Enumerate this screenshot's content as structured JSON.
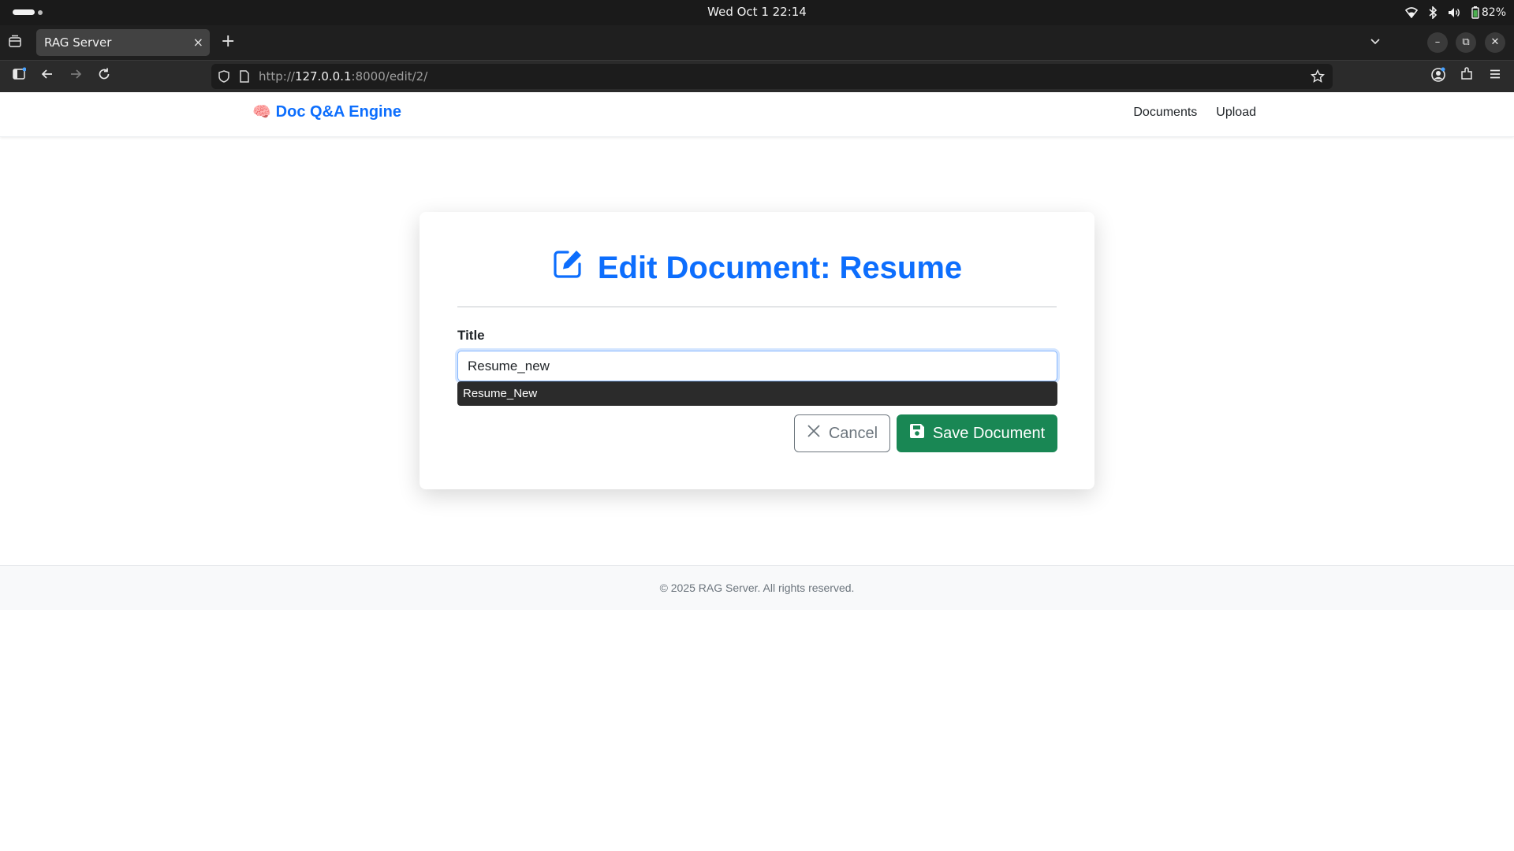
{
  "os": {
    "clock": "Wed Oct 1  22:14",
    "battery": "82%",
    "tray_icons": [
      "wifi-icon",
      "bluetooth-icon",
      "volume-icon",
      "battery-icon"
    ]
  },
  "browser": {
    "tab_title": "RAG Server",
    "tab_close": "×",
    "new_tab": "+",
    "url_prefix": "http://",
    "url_host": "127.0.0.1",
    "url_rest": ":8000/edit/2/",
    "window_minimize": "–",
    "window_restore": "⧉",
    "window_close": "✕"
  },
  "navbar": {
    "brand_icon": "🧠",
    "brand": "Doc Q&A Engine",
    "links": [
      "Documents",
      "Upload"
    ]
  },
  "form": {
    "heading": "Edit Document: Resume",
    "title_label": "Title",
    "title_value": "Resume_new",
    "autocomplete_suggestion": "Resume_New",
    "cancel_label": "Cancel",
    "save_label": "Save Document"
  },
  "footer": {
    "text": "© 2025 RAG Server. All rights reserved."
  },
  "colors": {
    "primary": "#0d6efd",
    "success": "#198754",
    "secondary": "#6c757d"
  }
}
